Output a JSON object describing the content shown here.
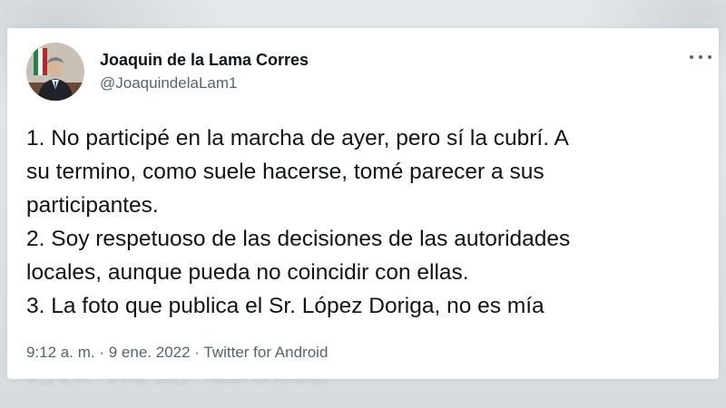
{
  "tweet": {
    "display_name": "Joaquin de la Lama Corres",
    "handle": "@JoaquindelaLam1",
    "more_icon": "more-horizontal-icon",
    "lines": [
      "1. No participé en la marcha de ayer, pero sí la cubrí. A",
      "su termino, como suele hacerse, tomé parecer a sus",
      "participantes.",
      "2. Soy respetuoso de las decisiones de las autoridades",
      "locales, aunque pueda no coincidir con ellas.",
      "3. La foto que publica el Sr. López Doriga, no es mía"
    ],
    "time": "9:12 a. m.",
    "separator": "·",
    "date": "9 ene. 2022",
    "source": "Twitter for Android"
  },
  "background_footer": "9:12 a. m. · 9 ene. 2022 · Twitter for Android",
  "colors": {
    "text_primary": "#0f1419",
    "text_secondary": "#536471",
    "card": "#ffffff"
  }
}
